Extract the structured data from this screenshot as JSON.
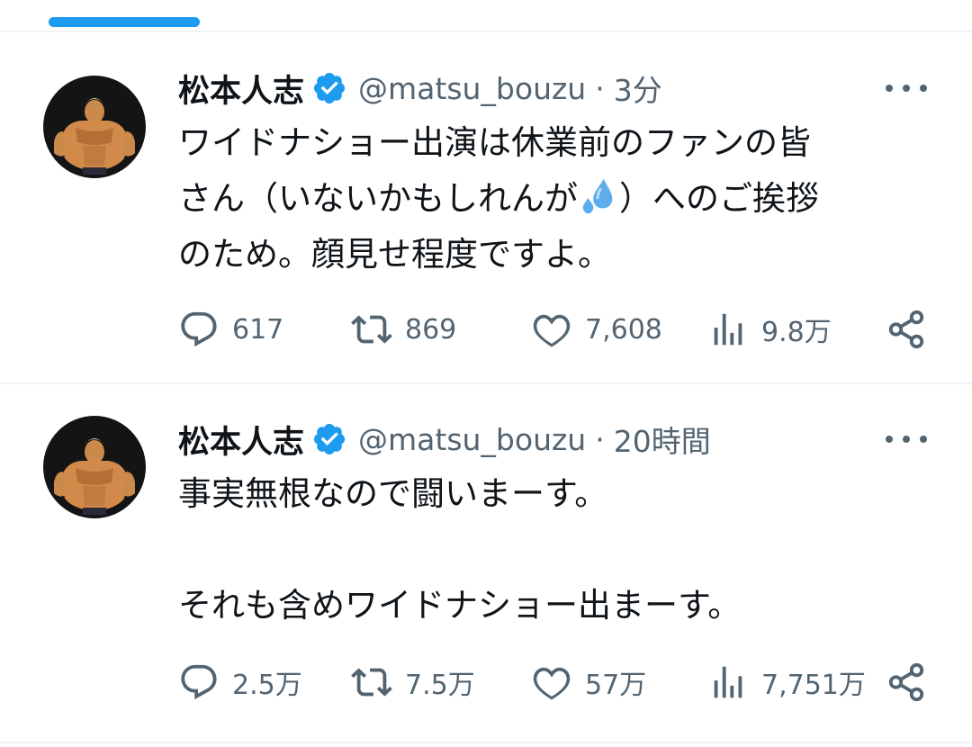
{
  "colors": {
    "accent": "#1d9bf0",
    "text": "#0f1419",
    "secondary": "#536471",
    "divider": "#eff3f4"
  },
  "tweets": [
    {
      "name": "松本人志",
      "handle": "@matsu_bouzu",
      "separator": "·",
      "time": "3分",
      "lines": [
        "ワイドナショー出演は休業前のファンの皆",
        "さん（いないかもしれんが",
        "）へのご挨拶",
        "のため。顔見せ程度ですよ。"
      ],
      "emoji": "sweat-droplets-icon",
      "replies": "617",
      "retweets": "869",
      "likes": "7,608",
      "views": "9.8万"
    },
    {
      "name": "松本人志",
      "handle": "@matsu_bouzu",
      "separator": "·",
      "time": "20時間",
      "lines": [
        "事実無根なので闘いまーす。",
        "",
        "それも含めワイドナショー出まーす。"
      ],
      "replies": "2.5万",
      "retweets": "7.5万",
      "likes": "57万",
      "views": "7,751万"
    }
  ]
}
